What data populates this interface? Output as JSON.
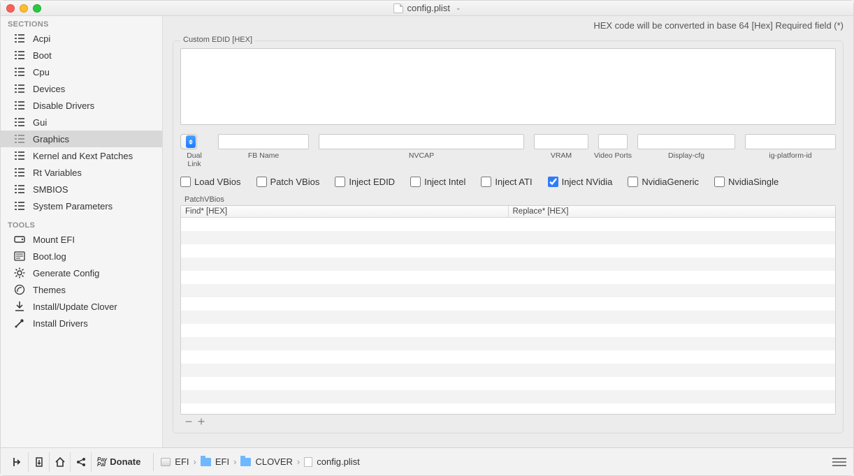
{
  "title": "config.plist",
  "info_line": "HEX code will be converted in base 64 [Hex]    Required field (*)",
  "sections_label": "SECTIONS",
  "tools_label": "TOOLS",
  "sections": [
    "Acpi",
    "Boot",
    "Cpu",
    "Devices",
    "Disable Drivers",
    "Gui",
    "Graphics",
    "Kernel and Kext Patches",
    "Rt Variables",
    "SMBIOS",
    "System Parameters"
  ],
  "selected_section_index": 6,
  "tools": [
    "Mount EFI",
    "Boot.log",
    "Generate Config",
    "Themes",
    "Install/Update Clover",
    "Install Drivers"
  ],
  "edid_group": "Custom EDID [HEX]",
  "edid_value": "",
  "fields": {
    "dual_link": {
      "label": "Dual Link",
      "value": ""
    },
    "fb_name": {
      "label": "FB Name",
      "value": ""
    },
    "nvcap": {
      "label": "NVCAP",
      "value": ""
    },
    "vram": {
      "label": "VRAM",
      "value": ""
    },
    "video_ports": {
      "label": "Video Ports",
      "value": ""
    },
    "display_cfg": {
      "label": "Display-cfg",
      "value": ""
    },
    "ig_platform": {
      "label": "ig-platform-id",
      "value": ""
    }
  },
  "checks": {
    "load_vbios": {
      "label": "Load VBios",
      "checked": false
    },
    "patch_vbios": {
      "label": "Patch VBios",
      "checked": false
    },
    "inject_edid": {
      "label": "Inject EDID",
      "checked": false
    },
    "inject_intel": {
      "label": "Inject Intel",
      "checked": false
    },
    "inject_ati": {
      "label": "Inject ATI",
      "checked": false
    },
    "inject_nvidia": {
      "label": "Inject NVidia",
      "checked": true
    },
    "nvidia_generic": {
      "label": "NvidiaGeneric",
      "checked": false
    },
    "nvidia_single": {
      "label": "NvidiaSingle",
      "checked": false
    }
  },
  "patch_label": "PatchVBios",
  "table_headers": [
    "Find* [HEX]",
    "Replace* [HEX]"
  ],
  "table_rows": [],
  "donate_label": "Donate",
  "breadcrumbs": [
    "EFI",
    "EFI",
    "CLOVER",
    "config.plist"
  ]
}
